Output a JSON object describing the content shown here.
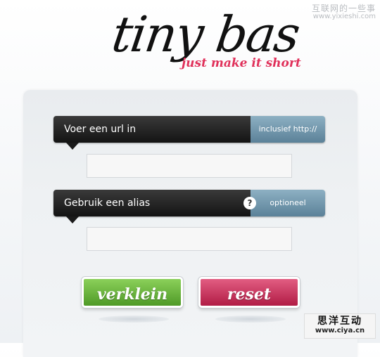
{
  "watermark": {
    "top_cn": "互联网的一些事",
    "top_url": "www.yixieshi.com",
    "bottom_cn": "思洋互动",
    "bottom_url": "www.ciya.cn"
  },
  "logo": {
    "title": "tiny bas",
    "tagline": "just make it short"
  },
  "url_section": {
    "label": "Voer een url in",
    "hint": "inclusief http://",
    "value": ""
  },
  "alias_section": {
    "label": "Gebruik een alias",
    "help_glyph": "?",
    "hint": "optioneel",
    "value": ""
  },
  "buttons": {
    "shorten": "verklein",
    "reset": "reset"
  },
  "colors": {
    "tagline": "#e0305a",
    "bar_dark": "#1a1a1a",
    "hint_blue": "#6f94a9",
    "shorten_green": "#62b033",
    "reset_pink": "#c8285a"
  }
}
